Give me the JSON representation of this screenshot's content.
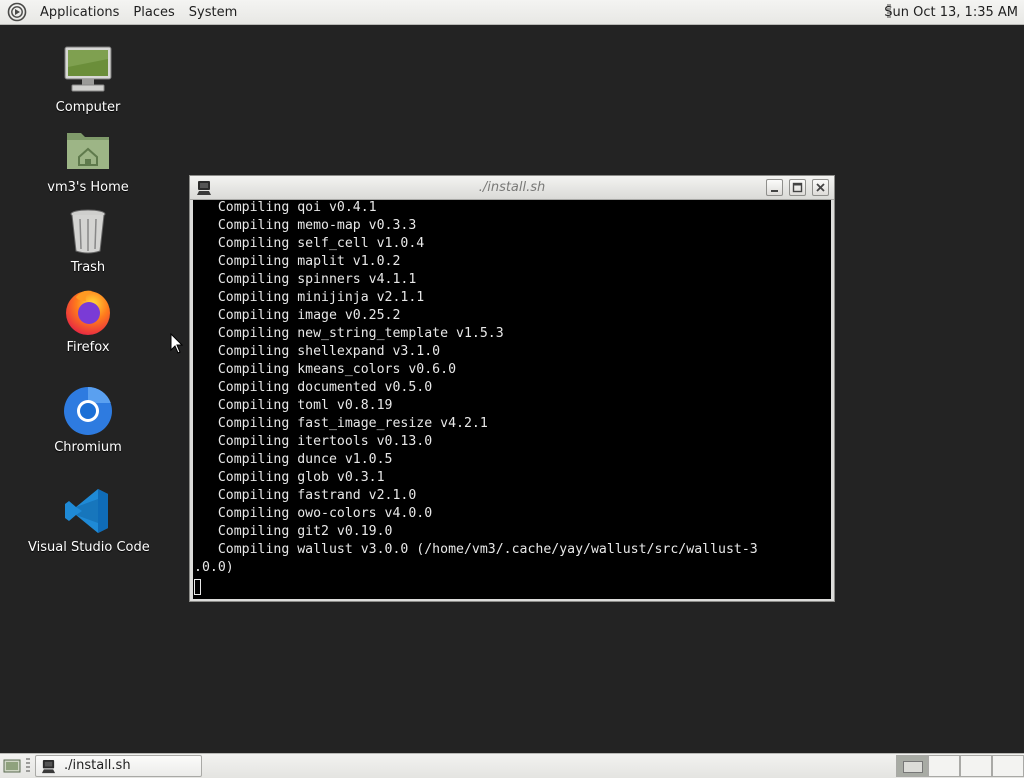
{
  "top_panel": {
    "menus": [
      "Applications",
      "Places",
      "System"
    ],
    "clock": "Sun Oct 13,  1:35 AM"
  },
  "desktop_icons": [
    {
      "label": "Computer",
      "icon": "computer-icon"
    },
    {
      "label": "vm3's Home",
      "icon": "home-folder-icon"
    },
    {
      "label": "Trash",
      "icon": "trash-icon"
    },
    {
      "label": "Firefox",
      "icon": "firefox-icon"
    },
    {
      "label": "Chromium",
      "icon": "chromium-icon"
    },
    {
      "label": "Visual Studio Code",
      "icon": "vscode-icon"
    }
  ],
  "terminal_window": {
    "title": "./install.sh",
    "lines": [
      "   Compiling qoi v0.4.1",
      "   Compiling memo-map v0.3.3",
      "   Compiling self_cell v1.0.4",
      "   Compiling maplit v1.0.2",
      "   Compiling spinners v4.1.1",
      "   Compiling minijinja v2.1.1",
      "   Compiling image v0.25.2",
      "   Compiling new_string_template v1.5.3",
      "   Compiling shellexpand v3.1.0",
      "   Compiling kmeans_colors v0.6.0",
      "   Compiling documented v0.5.0",
      "   Compiling toml v0.8.19",
      "   Compiling fast_image_resize v4.2.1",
      "   Compiling itertools v0.13.0",
      "   Compiling dunce v1.0.5",
      "   Compiling glob v0.3.1",
      "   Compiling fastrand v2.1.0",
      "   Compiling owo-colors v4.0.0",
      "   Compiling git2 v0.19.0",
      "   Compiling wallust v3.0.0 (/home/vm3/.cache/yay/wallust/src/wallust-3",
      ".0.0)"
    ]
  },
  "bottom_panel": {
    "task_label": "./install.sh",
    "workspaces": 4,
    "active_workspace": 1
  }
}
